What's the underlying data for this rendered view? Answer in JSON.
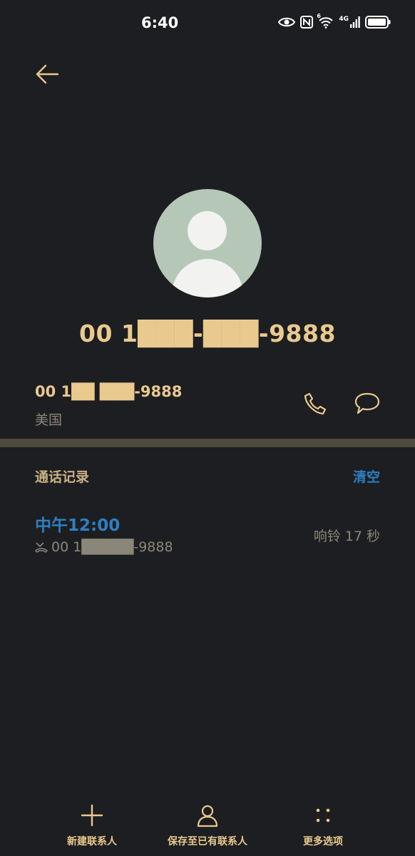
{
  "status_bar": {
    "time": "6:40",
    "icons": [
      "eye-icon",
      "nfc-icon",
      "wifi-6-icon",
      "4g-signal-icon",
      "battery-icon"
    ],
    "network_label": "4G",
    "wifi_label": "6"
  },
  "contact": {
    "number": "00 1███-███-9888",
    "avatar": "person-avatar-icon"
  },
  "number_row": {
    "number": "00 1██ ███-9888",
    "region": "美国"
  },
  "call_log": {
    "title": "通话记录",
    "clear_label": "清空",
    "entries": [
      {
        "time": "中午12:00",
        "number": "00 1█████-9888",
        "duration": "响铃 17 秒",
        "type_icon": "missed-call-icon"
      }
    ]
  },
  "bottom_bar": {
    "new_contact": "新建联系人",
    "save_existing": "保存至已有联系人",
    "more_options": "更多选项"
  },
  "colors": {
    "background": "#1d1e21",
    "accent": "#e9c98e",
    "link": "#2d7fc2",
    "secondary_text": "#8a8778",
    "divider": "#4e4a3d",
    "avatar_bg": "#b5c8b8"
  }
}
